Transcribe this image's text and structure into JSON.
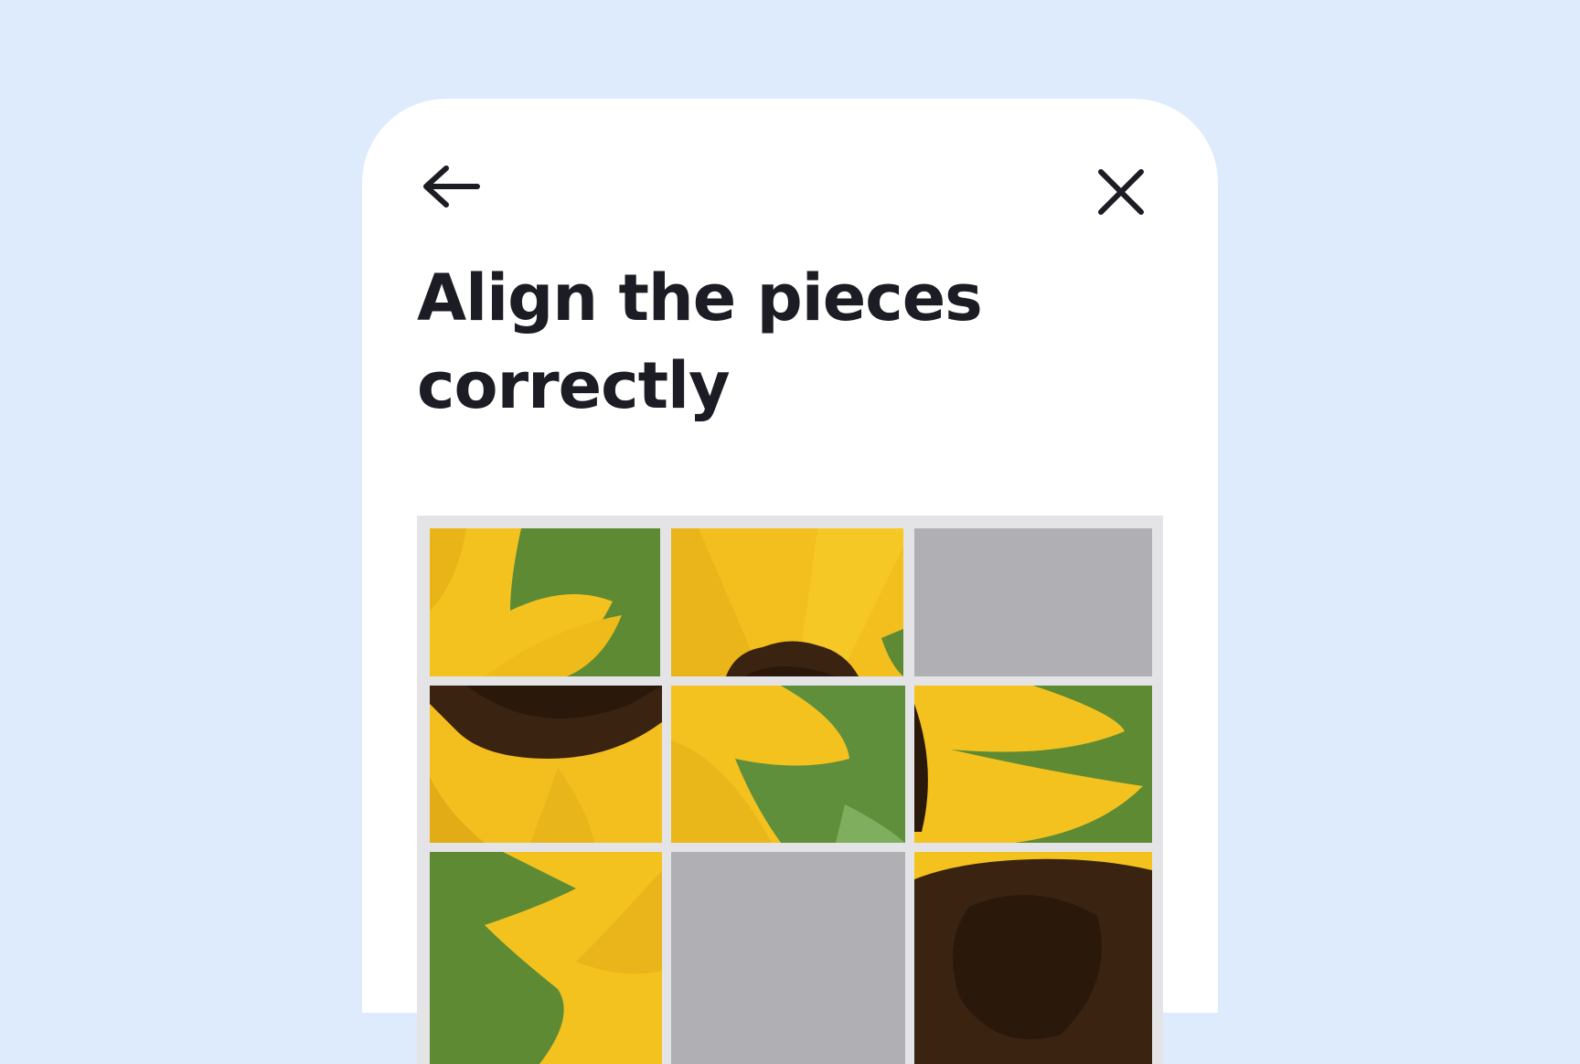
{
  "header": {
    "back_icon": "arrow-left-icon",
    "close_icon": "close-icon"
  },
  "title": "Align the pieces correctly",
  "puzzle": {
    "rows": 3,
    "columns": 3,
    "tiles": [
      {
        "row": 1,
        "col": 1,
        "state": "piece",
        "content": "sunflower-petals-top-left"
      },
      {
        "row": 1,
        "col": 2,
        "state": "piece",
        "content": "sunflower-petals-top-center"
      },
      {
        "row": 1,
        "col": 3,
        "state": "empty"
      },
      {
        "row": 2,
        "col": 1,
        "state": "piece",
        "content": "sunflower-center-left"
      },
      {
        "row": 2,
        "col": 2,
        "state": "piece",
        "content": "sunflower-petals-middle"
      },
      {
        "row": 2,
        "col": 3,
        "state": "piece",
        "content": "sunflower-petals-right"
      },
      {
        "row": 3,
        "col": 1,
        "state": "piece",
        "content": "sunflower-petals-bottom-left"
      },
      {
        "row": 3,
        "col": 2,
        "state": "empty"
      },
      {
        "row": 3,
        "col": 3,
        "state": "piece",
        "content": "sunflower-center-bottom-right"
      }
    ]
  },
  "colors": {
    "background": "#deebfc",
    "card": "#ffffff",
    "text": "#1c1d24",
    "board": "#e4e4e7",
    "empty_slot": "#b0afb4",
    "petal": "#f3c21f",
    "leaf": "#5e8a34",
    "seed": "#3a2310"
  }
}
